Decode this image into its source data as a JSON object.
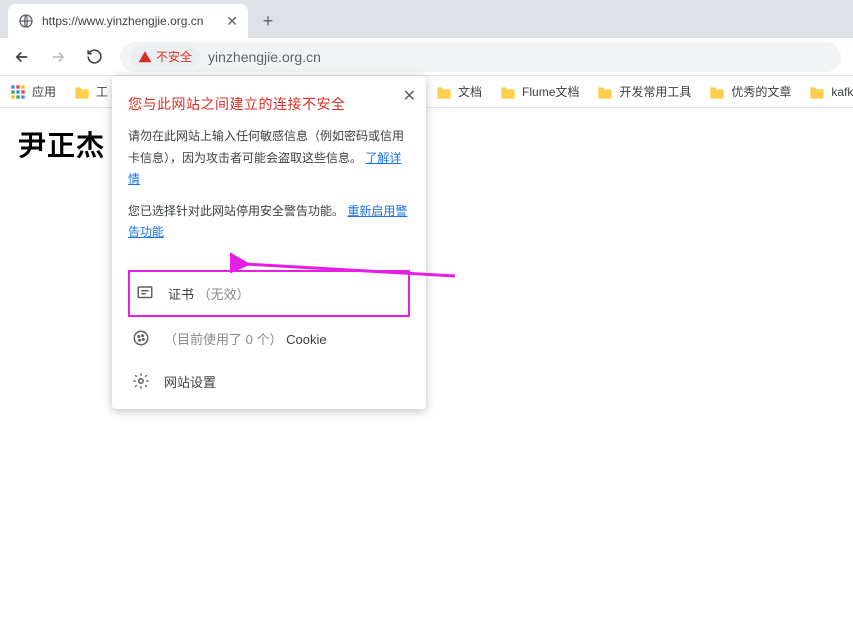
{
  "tab": {
    "title": "https://www.yinzhengjie.org.cn"
  },
  "addressbar": {
    "security_label": "不安全",
    "url": "yinzhengjie.org.cn"
  },
  "bookmarks": {
    "apps_label": "应用",
    "items": [
      {
        "label": "工"
      },
      {
        "label": "文档"
      },
      {
        "label": "Flume文档"
      },
      {
        "label": "开发常用工具"
      },
      {
        "label": "优秀的文章"
      },
      {
        "label": "kafka"
      }
    ]
  },
  "page": {
    "heading": "尹正杰"
  },
  "popover": {
    "title": "您与此网站之间建立的连接不安全",
    "para1_a": "请勿在此网站上输入任何敏感信息（例如密码或信用卡信息），因为攻击者可能会盗取这些信息。",
    "para1_link": "了解详情",
    "para2_a": "您已选择针对此网站停用安全警告功能。",
    "para2_link": "重新启用警告功能",
    "cert_label_a": "证书 ",
    "cert_label_b": "（无效）",
    "cookie_label_a": "（目前使用了 0 个）",
    "cookie_label_b": "Cookie",
    "settings_label": "网站设置"
  }
}
